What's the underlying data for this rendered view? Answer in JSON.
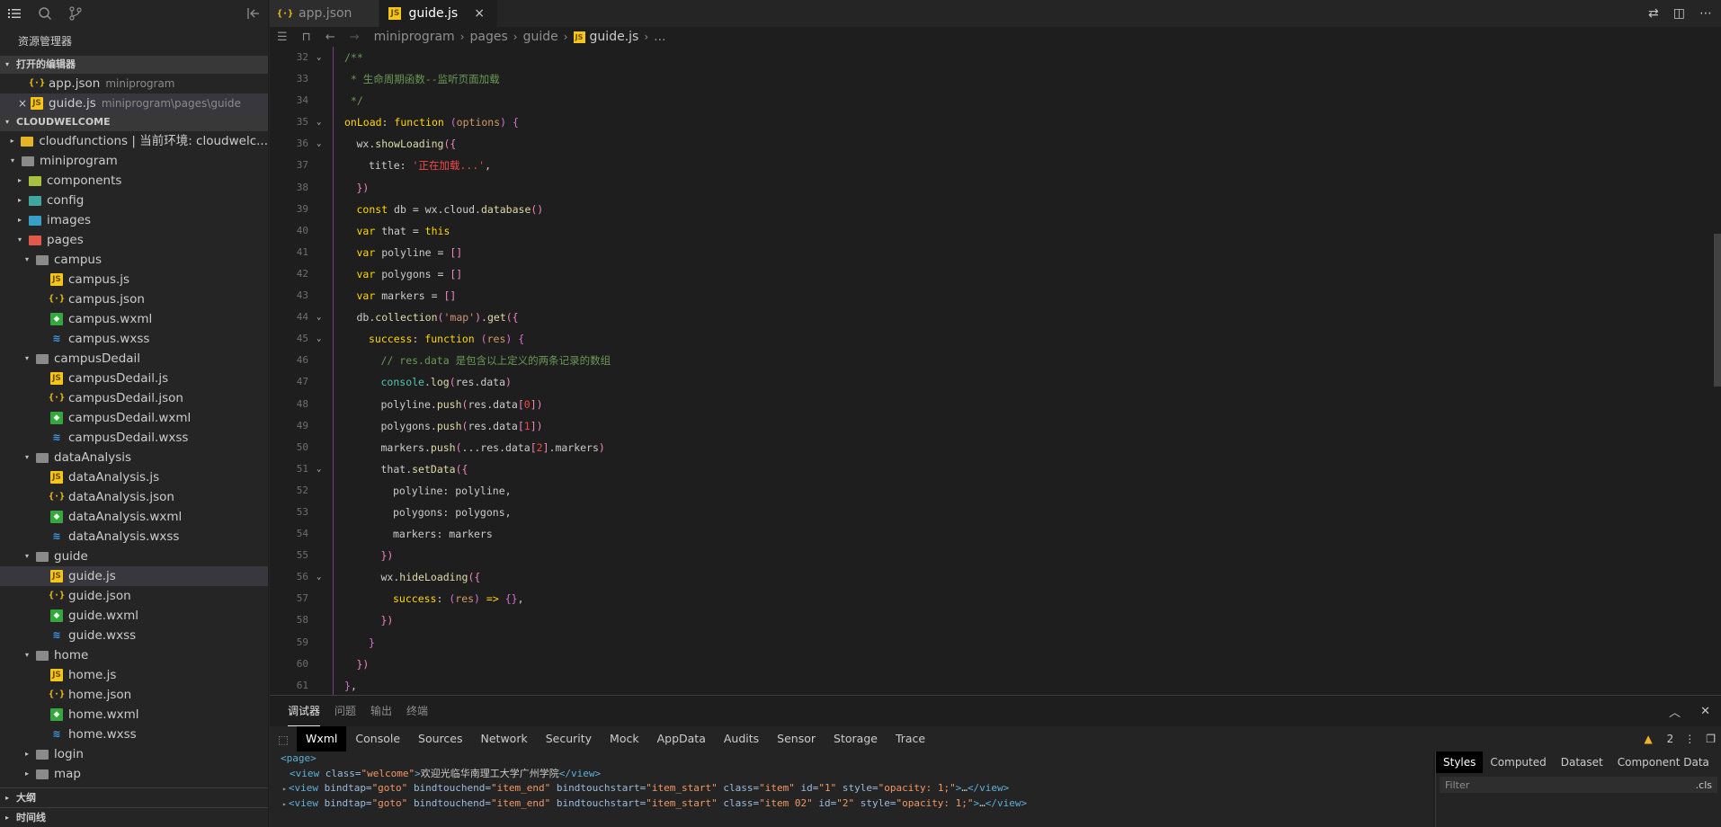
{
  "activity": {
    "icons": [
      "menu-icon",
      "search-icon",
      "source-control-icon",
      "collapse-sidebar-icon"
    ]
  },
  "sidebar": {
    "title": "资源管理器",
    "open_editors_title": "打开的编辑器",
    "open_editors": [
      {
        "name": "app.json",
        "desc": "miniprogram",
        "type": "json",
        "selected": false
      },
      {
        "name": "guide.js",
        "desc": "miniprogram\\pages\\guide",
        "type": "js",
        "selected": true,
        "close": "×"
      }
    ],
    "project_title": "CLOUDWELCOME",
    "tree": [
      {
        "name": "cloudfunctions | 当前环境: cloudwelc...",
        "depth": 1,
        "twisty": "▸",
        "type": "folder-yellow"
      },
      {
        "name": "miniprogram",
        "depth": 1,
        "twisty": "▾",
        "type": "folder"
      },
      {
        "name": "components",
        "depth": 2,
        "twisty": "▸",
        "type": "folder-green"
      },
      {
        "name": "config",
        "depth": 2,
        "twisty": "▸",
        "type": "folder-teal"
      },
      {
        "name": "images",
        "depth": 2,
        "twisty": "▸",
        "type": "folder-blue"
      },
      {
        "name": "pages",
        "depth": 2,
        "twisty": "▾",
        "type": "folder-red"
      },
      {
        "name": "campus",
        "depth": 3,
        "twisty": "▾",
        "type": "folder"
      },
      {
        "name": "campus.js",
        "depth": 4,
        "twisty": "",
        "type": "js"
      },
      {
        "name": "campus.json",
        "depth": 4,
        "twisty": "",
        "type": "json"
      },
      {
        "name": "campus.wxml",
        "depth": 4,
        "twisty": "",
        "type": "wxml"
      },
      {
        "name": "campus.wxss",
        "depth": 4,
        "twisty": "",
        "type": "wxss"
      },
      {
        "name": "campusDedail",
        "depth": 3,
        "twisty": "▾",
        "type": "folder"
      },
      {
        "name": "campusDedail.js",
        "depth": 4,
        "twisty": "",
        "type": "js"
      },
      {
        "name": "campusDedail.json",
        "depth": 4,
        "twisty": "",
        "type": "json"
      },
      {
        "name": "campusDedail.wxml",
        "depth": 4,
        "twisty": "",
        "type": "wxml"
      },
      {
        "name": "campusDedail.wxss",
        "depth": 4,
        "twisty": "",
        "type": "wxss"
      },
      {
        "name": "dataAnalysis",
        "depth": 3,
        "twisty": "▾",
        "type": "folder"
      },
      {
        "name": "dataAnalysis.js",
        "depth": 4,
        "twisty": "",
        "type": "js"
      },
      {
        "name": "dataAnalysis.json",
        "depth": 4,
        "twisty": "",
        "type": "json"
      },
      {
        "name": "dataAnalysis.wxml",
        "depth": 4,
        "twisty": "",
        "type": "wxml"
      },
      {
        "name": "dataAnalysis.wxss",
        "depth": 4,
        "twisty": "",
        "type": "wxss"
      },
      {
        "name": "guide",
        "depth": 3,
        "twisty": "▾",
        "type": "folder"
      },
      {
        "name": "guide.js",
        "depth": 4,
        "twisty": "",
        "type": "js",
        "selected": true
      },
      {
        "name": "guide.json",
        "depth": 4,
        "twisty": "",
        "type": "json"
      },
      {
        "name": "guide.wxml",
        "depth": 4,
        "twisty": "",
        "type": "wxml"
      },
      {
        "name": "guide.wxss",
        "depth": 4,
        "twisty": "",
        "type": "wxss"
      },
      {
        "name": "home",
        "depth": 3,
        "twisty": "▾",
        "type": "folder"
      },
      {
        "name": "home.js",
        "depth": 4,
        "twisty": "",
        "type": "js"
      },
      {
        "name": "home.json",
        "depth": 4,
        "twisty": "",
        "type": "json"
      },
      {
        "name": "home.wxml",
        "depth": 4,
        "twisty": "",
        "type": "wxml"
      },
      {
        "name": "home.wxss",
        "depth": 4,
        "twisty": "",
        "type": "wxss"
      },
      {
        "name": "login",
        "depth": 3,
        "twisty": "▸",
        "type": "folder"
      },
      {
        "name": "map",
        "depth": 3,
        "twisty": "▸",
        "type": "folder"
      }
    ],
    "outline_title": "大纲",
    "timeline_title": "时间线"
  },
  "editor": {
    "tabs": [
      {
        "name": "app.json",
        "type": "json",
        "active": false
      },
      {
        "name": "guide.js",
        "type": "js",
        "active": true,
        "close": "×"
      }
    ],
    "breadcrumb": [
      "miniprogram",
      "pages",
      "guide",
      "guide.js",
      "..."
    ],
    "lines": [
      {
        "n": "32",
        "fold": "⌄",
        "depth": 0,
        "html": "<span class='c'>/**</span>"
      },
      {
        "n": "33",
        "fold": "",
        "depth": 0,
        "html": "<span class='c'> * 生命周期函数--监听页面加载</span>"
      },
      {
        "n": "34",
        "fold": "",
        "depth": 0,
        "html": "<span class='c'> */</span>"
      },
      {
        "n": "35",
        "fold": "⌄",
        "depth": 0,
        "html": "<span class='y'>onLoad</span>: <span class='y'>function</span> <span class='pr'>(</span><span class='o'>options</span><span class='pr'>)</span> <span class='pr'>{</span>"
      },
      {
        "n": "36",
        "fold": "⌄",
        "depth": 1,
        "html": "wx.<span class='f'>showLoading</span><span class='pk'>({</span>"
      },
      {
        "n": "37",
        "fold": "",
        "depth": 2,
        "html": "title: <span class='sr'>'正在加载...'</span>,"
      },
      {
        "n": "38",
        "fold": "",
        "depth": 1,
        "html": "<span class='pk'>})</span>"
      },
      {
        "n": "39",
        "fold": "",
        "depth": 1,
        "html": "<span class='y'>const</span> db = wx.cloud.<span class='f'>database</span><span class='pk'>()</span>"
      },
      {
        "n": "40",
        "fold": "",
        "depth": 1,
        "html": "<span class='y'>var</span> that = <span class='y'>this</span>"
      },
      {
        "n": "41",
        "fold": "",
        "depth": 1,
        "html": "<span class='y'>var</span> polyline = <span class='pk'>[]</span>"
      },
      {
        "n": "42",
        "fold": "",
        "depth": 1,
        "html": "<span class='y'>var</span> polygons = <span class='pk'>[]</span>"
      },
      {
        "n": "43",
        "fold": "",
        "depth": 1,
        "html": "<span class='y'>var</span> markers = <span class='pk'>[]</span>"
      },
      {
        "n": "44",
        "fold": "⌄",
        "depth": 1,
        "html": "db.<span class='f'>collection</span><span class='pk'>(</span><span class='s'>'map'</span><span class='pk'>)</span>.<span class='f'>get</span><span class='pk'>({</span>"
      },
      {
        "n": "45",
        "fold": "⌄",
        "depth": 2,
        "html": "<span class='y'>success</span>: <span class='y'>function</span> <span class='pr'>(</span><span class='o'>res</span><span class='pr'>)</span> <span class='pr'>{</span>"
      },
      {
        "n": "46",
        "fold": "",
        "depth": 3,
        "html": "<span class='c'>// res.data 是包含以上定义的两条记录的数组</span>"
      },
      {
        "n": "47",
        "fold": "",
        "depth": 3,
        "html": "<span class='tl'>console</span>.<span class='f'>log</span><span class='pk'>(</span>res.data<span class='pk'>)</span>"
      },
      {
        "n": "48",
        "fold": "",
        "depth": 3,
        "html": "polyline.<span class='f'>push</span><span class='pk'>(</span>res.data<span class='pk'>[</span><span class='sr'>0</span><span class='pk'>]</span><span class='pk'>)</span>"
      },
      {
        "n": "49",
        "fold": "",
        "depth": 3,
        "html": "polygons.<span class='f'>push</span><span class='pk'>(</span>res.data<span class='pk'>[</span><span class='sr'>1</span><span class='pk'>]</span><span class='pk'>)</span>"
      },
      {
        "n": "50",
        "fold": "",
        "depth": 3,
        "html": "markers.<span class='f'>push</span><span class='pk'>(</span>...res.data<span class='pk'>[</span><span class='sr'>2</span><span class='pk'>]</span>.markers<span class='pk'>)</span>"
      },
      {
        "n": "51",
        "fold": "⌄",
        "depth": 3,
        "html": "that.<span class='f'>setData</span><span class='pk'>({</span>"
      },
      {
        "n": "52",
        "fold": "",
        "depth": 4,
        "html": "polyline: polyline,"
      },
      {
        "n": "53",
        "fold": "",
        "depth": 4,
        "html": "polygons: polygons,"
      },
      {
        "n": "54",
        "fold": "",
        "depth": 4,
        "html": "markers: markers"
      },
      {
        "n": "55",
        "fold": "",
        "depth": 3,
        "html": "<span class='pk'>})</span>"
      },
      {
        "n": "56",
        "fold": "⌄",
        "depth": 3,
        "html": "wx.<span class='f'>hideLoading</span><span class='pk'>({</span>"
      },
      {
        "n": "57",
        "fold": "",
        "depth": 4,
        "html": "<span class='y'>success</span>: <span class='pr'>(</span><span class='o'>res</span><span class='pr'>)</span> <span class='y'>=&gt;</span> <span class='pr'>{}</span>,"
      },
      {
        "n": "58",
        "fold": "",
        "depth": 3,
        "html": "<span class='pk'>})</span>"
      },
      {
        "n": "59",
        "fold": "",
        "depth": 2,
        "html": "<span class='pr'>}</span>"
      },
      {
        "n": "60",
        "fold": "",
        "depth": 1,
        "html": "<span class='pk'>})</span>"
      },
      {
        "n": "61",
        "fold": "",
        "depth": 0,
        "html": "<span class='pr'>}</span>,"
      }
    ]
  },
  "panel": {
    "tabs": [
      "调试器",
      "问题",
      "输出",
      "终端"
    ],
    "devtools_tabs": [
      "Wxml",
      "Console",
      "Sources",
      "Network",
      "Security",
      "Mock",
      "AppData",
      "Audits",
      "Sensor",
      "Storage",
      "Trace"
    ],
    "warning_count": "2",
    "warning_icon": "▲",
    "wxml_lines": [
      {
        "indent": 0,
        "arrow": "",
        "html": "<span class='tg'>&lt;page&gt;</span>"
      },
      {
        "indent": 1,
        "arrow": "",
        "html": "<span class='tg'>&lt;view</span> <span class='at'>class=</span><span class='av'>\"welcome\"</span><span class='tg'>&gt;</span><span class='wt'>欢迎光临华南理工大学广州学院</span><span class='tg'>&lt;/view&gt;</span>"
      },
      {
        "indent": 1,
        "arrow": "▸",
        "html": "<span class='tg'>&lt;view</span> <span class='at'>bindtap=</span><span class='av'>\"goto\"</span> <span class='at'>bindtouchend=</span><span class='av'>\"item_end\"</span> <span class='at'>bindtouchstart=</span><span class='av'>\"item_start\"</span> <span class='at'>class=</span><span class='av'>\"item\"</span> <span class='at'>id=</span><span class='av'>\"1\"</span> <span class='at'>style=</span><span class='av'>\"opacity: 1;\"</span><span class='tg'>&gt;</span><span class='wt'>…</span><span class='tg'>&lt;/view&gt;</span>"
      },
      {
        "indent": 1,
        "arrow": "▸",
        "html": "<span class='tg'>&lt;view</span> <span class='at'>bindtap=</span><span class='av'>\"goto\"</span> <span class='at'>bindtouchend=</span><span class='av'>\"item_end\"</span> <span class='at'>bindtouchstart=</span><span class='av'>\"item_start\"</span> <span class='at'>class=</span><span class='av'>\"item 02\"</span> <span class='at'>id=</span><span class='av'>\"2\"</span> <span class='at'>style=</span><span class='av'>\"opacity: 1;\"</span><span class='tg'>&gt;</span><span class='wt'>…</span><span class='tg'>&lt;/view&gt;</span>"
      }
    ],
    "styles_tabs": [
      "Styles",
      "Computed",
      "Dataset",
      "Component Data"
    ],
    "filter_placeholder": "Filter",
    "cls_label": ".cls"
  }
}
